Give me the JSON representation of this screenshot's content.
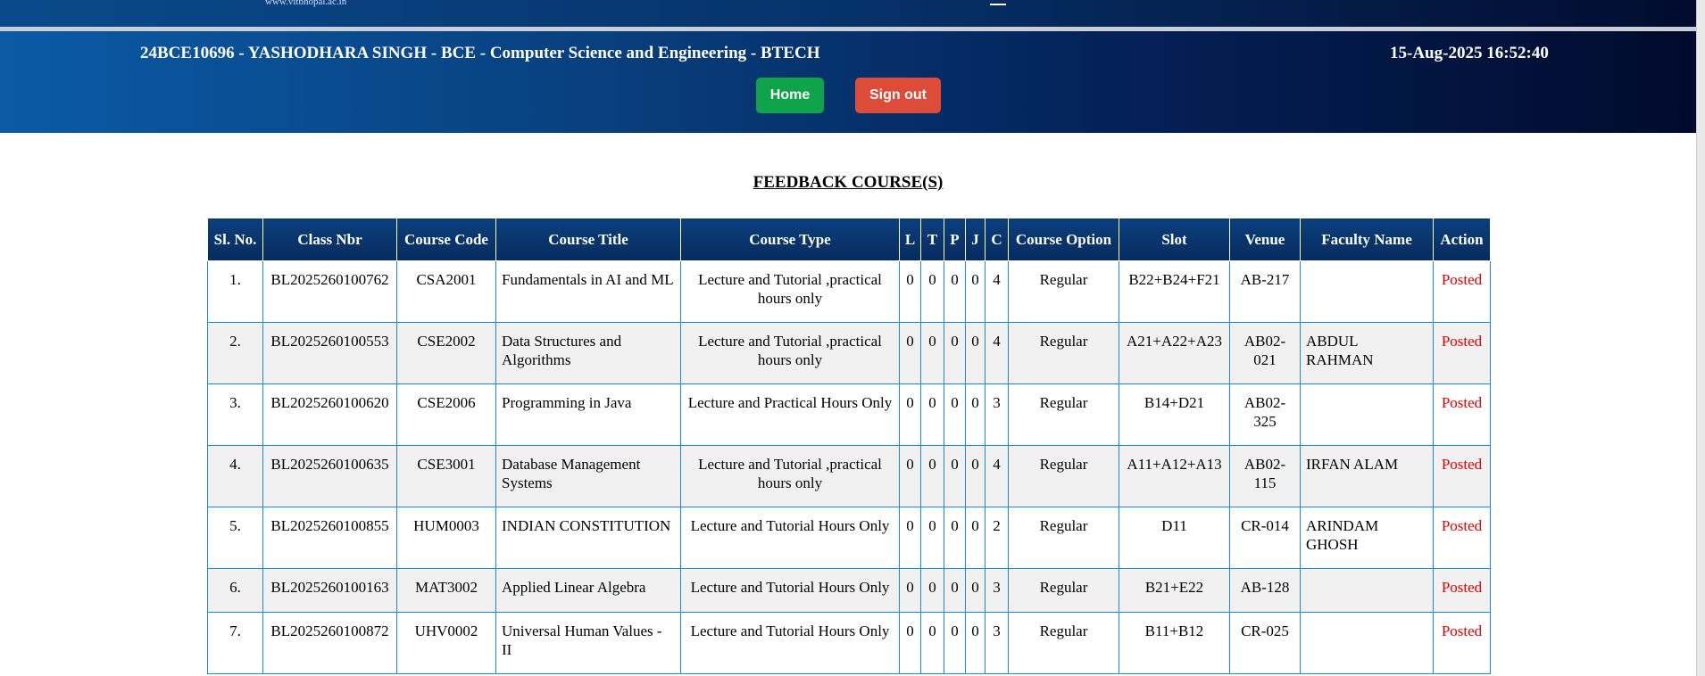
{
  "site": {
    "url": "www.vitbhopal.ac.in"
  },
  "header": {
    "user_line": "24BCE10696 - YASHODHARA SINGH - BCE - Computer Science and Engineering - BTECH",
    "datetime": "15-Aug-2025 16:52:40",
    "home_label": "Home",
    "signout_label": "Sign out"
  },
  "page": {
    "title": "FEEDBACK COURSE(S)"
  },
  "table": {
    "columns": [
      "Sl. No.",
      "Class Nbr",
      "Course Code",
      "Course Title",
      "Course Type",
      "L",
      "T",
      "P",
      "J",
      "C",
      "Course Option",
      "Slot",
      "Venue",
      "Faculty Name",
      "Action"
    ],
    "rows": [
      {
        "sl": "1.",
        "class_nbr": "BL2025260100762",
        "code": "CSA2001",
        "title": "Fundamentals in AI and ML",
        "type": "Lecture and Tutorial ,practical hours only",
        "l": "0",
        "t": "0",
        "p": "0",
        "j": "0",
        "c": "4",
        "option": "Regular",
        "slot": "B22+B24+F21",
        "venue": "AB-217",
        "faculty": "",
        "action": "Posted"
      },
      {
        "sl": "2.",
        "class_nbr": "BL2025260100553",
        "code": "CSE2002",
        "title": "Data Structures and Algorithms",
        "type": "Lecture and Tutorial ,practical hours only",
        "l": "0",
        "t": "0",
        "p": "0",
        "j": "0",
        "c": "4",
        "option": "Regular",
        "slot": "A21+A22+A23",
        "venue": "AB02-021",
        "faculty": "ABDUL RAHMAN",
        "action": "Posted"
      },
      {
        "sl": "3.",
        "class_nbr": "BL2025260100620",
        "code": "CSE2006",
        "title": "Programming in Java",
        "type": "Lecture and Practical Hours Only",
        "l": "0",
        "t": "0",
        "p": "0",
        "j": "0",
        "c": "3",
        "option": "Regular",
        "slot": "B14+D21",
        "venue": "AB02-325",
        "faculty": "",
        "action": "Posted"
      },
      {
        "sl": "4.",
        "class_nbr": "BL2025260100635",
        "code": "CSE3001",
        "title": "Database Management Systems",
        "type": "Lecture and Tutorial ,practical hours only",
        "l": "0",
        "t": "0",
        "p": "0",
        "j": "0",
        "c": "4",
        "option": "Regular",
        "slot": "A11+A12+A13",
        "venue": "AB02-115",
        "faculty": "IRFAN ALAM",
        "action": "Posted"
      },
      {
        "sl": "5.",
        "class_nbr": "BL2025260100855",
        "code": "HUM0003",
        "title": "INDIAN CONSTITUTION",
        "type": "Lecture and Tutorial Hours Only",
        "l": "0",
        "t": "0",
        "p": "0",
        "j": "0",
        "c": "2",
        "option": "Regular",
        "slot": "D11",
        "venue": "CR-014",
        "faculty": "ARINDAM GHOSH",
        "action": "Posted"
      },
      {
        "sl": "6.",
        "class_nbr": "BL2025260100163",
        "code": "MAT3002",
        "title": "Applied Linear Algebra",
        "type": "Lecture and Tutorial Hours Only",
        "l": "0",
        "t": "0",
        "p": "0",
        "j": "0",
        "c": "3",
        "option": "Regular",
        "slot": "B21+E22",
        "venue": "AB-128",
        "faculty": "",
        "action": "Posted"
      },
      {
        "sl": "7.",
        "class_nbr": "BL2025260100872",
        "code": "UHV0002",
        "title": "Universal Human Values - II",
        "type": "Lecture and Tutorial Hours Only",
        "l": "0",
        "t": "0",
        "p": "0",
        "j": "0",
        "c": "3",
        "option": "Regular",
        "slot": "B11+B12",
        "venue": "CR-025",
        "faculty": "",
        "action": "Posted"
      }
    ]
  },
  "colors": {
    "header_start": "#0b5aa6",
    "header_end": "#010a2c",
    "home": "#0fa34a",
    "signout": "#dd4b39",
    "posted": "#e60000",
    "border": "#1b8ad6"
  }
}
